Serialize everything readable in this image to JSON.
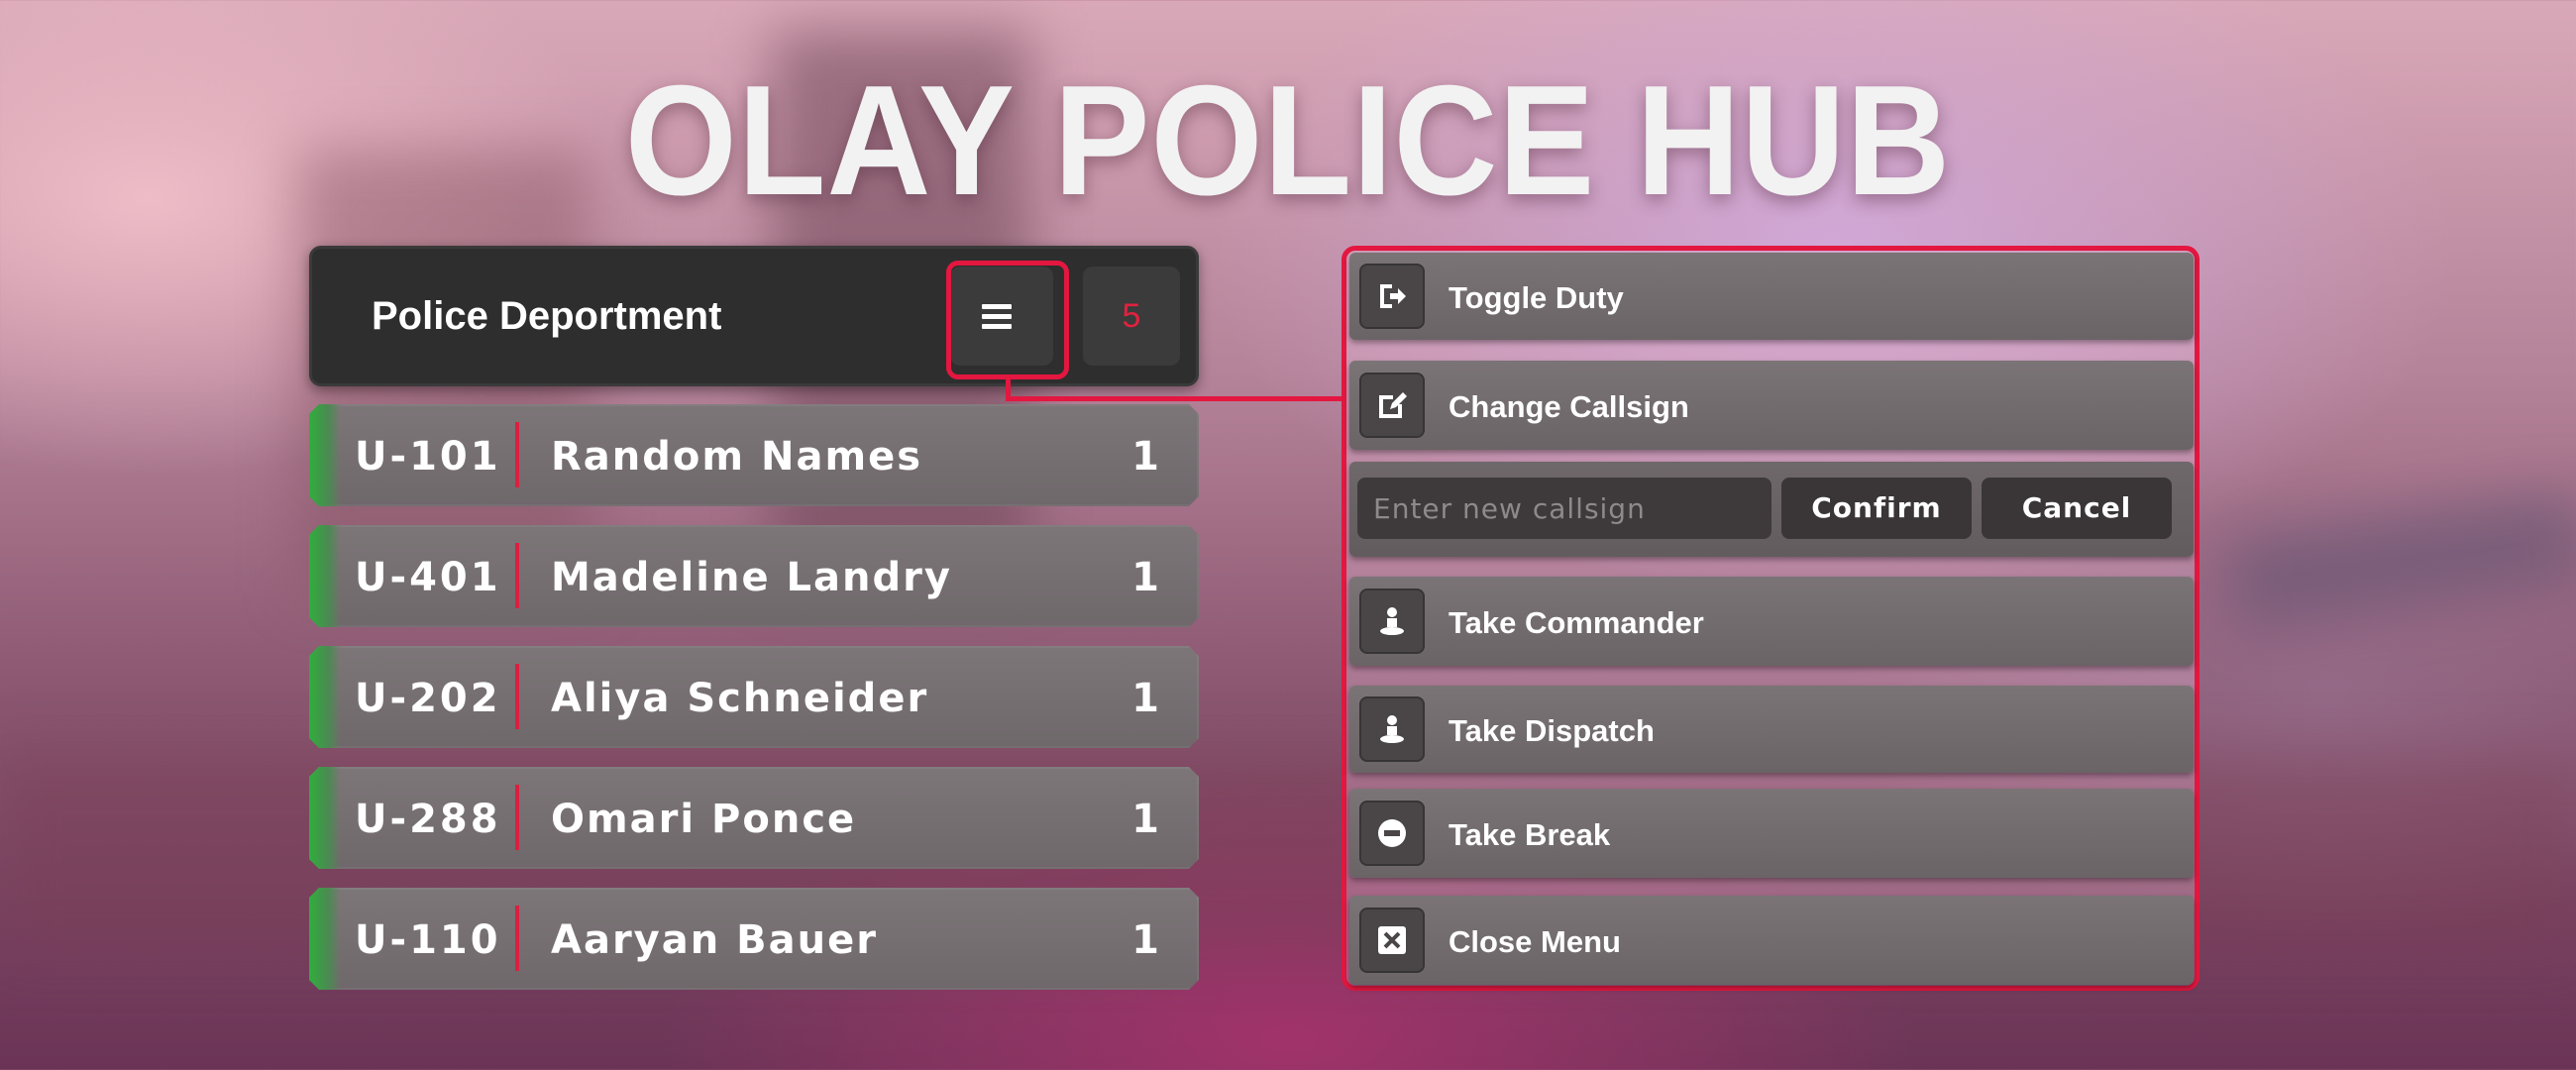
{
  "title": "OLAY POLICE HUB",
  "department": {
    "name": "Police Deportment",
    "menu_icon": "hamburger-menu-icon",
    "unit_count": "5"
  },
  "units": [
    {
      "callsign": "U-101",
      "name": "Random Names",
      "count": "1",
      "status_color": "#2fae3c"
    },
    {
      "callsign": "U-401",
      "name": "Madeline Landry",
      "count": "1",
      "status_color": "#2fae3c"
    },
    {
      "callsign": "U-202",
      "name": "Aliya Schneider",
      "count": "1",
      "status_color": "#2fae3c"
    },
    {
      "callsign": "U-288",
      "name": "Omari Ponce",
      "count": "1",
      "status_color": "#2fae3c"
    },
    {
      "callsign": "U-110",
      "name": "Aaryan Bauer",
      "count": "1",
      "status_color": "#2fae3c"
    }
  ],
  "menu": {
    "toggle_duty": {
      "label": "Toggle Duty",
      "icon": "sign-out-icon"
    },
    "change_callsign": {
      "label": "Change Callsign",
      "icon": "edit-icon"
    },
    "callsign_input": {
      "placeholder": "Enter new callsign"
    },
    "confirm_label": "Confirm",
    "cancel_label": "Cancel",
    "take_commander": {
      "label": "Take Commander",
      "icon": "person-icon"
    },
    "take_dispatch": {
      "label": "Take Dispatch",
      "icon": "person-icon"
    },
    "take_break": {
      "label": "Take Break",
      "icon": "minus-circle-icon"
    },
    "close_menu": {
      "label": "Close Menu",
      "icon": "close-square-icon"
    }
  },
  "colors": {
    "accent": "#e3173f",
    "panel": "#2e2e2e",
    "on_duty": "#2fae3c"
  }
}
